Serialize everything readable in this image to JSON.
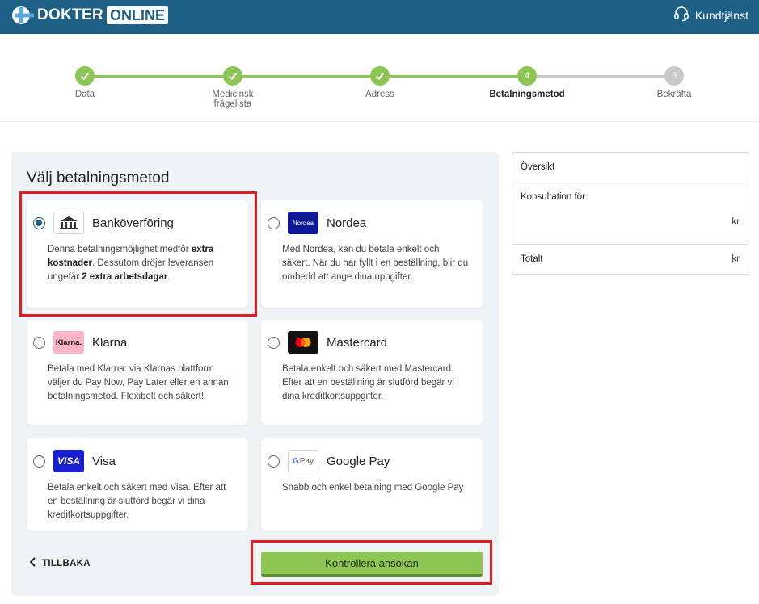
{
  "header": {
    "brand_part1": "DOKTER",
    "brand_part2": "ONLINE",
    "support_label": "Kundtjänst",
    "colors": {
      "bar": "#1e5f86"
    }
  },
  "stepper": {
    "steps": [
      {
        "number": "1",
        "label": "Data",
        "state": "done"
      },
      {
        "number": "2",
        "label": "Medicinsk\nfrågelista",
        "state": "done"
      },
      {
        "number": "3",
        "label": "Adress",
        "state": "done"
      },
      {
        "number": "4",
        "label": "Betalningsmetod",
        "state": "active"
      },
      {
        "number": "5",
        "label": "Bekräfta",
        "state": "todo"
      }
    ],
    "colors": {
      "done": "#8dc655",
      "todo": "#c9c9c9"
    }
  },
  "payment": {
    "title": "Välj betalningsmetod",
    "methods": [
      {
        "name": "Banköverföring",
        "selected": true,
        "icon": "bank-icon",
        "desc_parts": [
          "Denna betalningsmöjlighet medför ",
          "extra kostnader",
          ". Dessutom dröjer leveransen ungefär ",
          "2 extra arbetsdagar",
          "."
        ]
      },
      {
        "name": "Nordea",
        "selected": false,
        "icon": "nordea-logo",
        "logo_text": "Nordea",
        "desc": "Med Nordea, kan du betala enkelt och säkert. När du har fyllt i en beställning, blir du ombedd att ange dina uppgifter."
      },
      {
        "name": "Klarna",
        "selected": false,
        "icon": "klarna-logo",
        "logo_text": "Klarna.",
        "desc": "Betala med Klarna: via Klarnas plattform väljer du Pay Now, Pay Later eller en annan betalningsmetod. Flexibelt och säkert!"
      },
      {
        "name": "Mastercard",
        "selected": false,
        "icon": "mastercard-logo",
        "desc": "Betala enkelt och säkert med Mastercard. Efter att en beställning är slutförd begär vi dina kreditkortsuppgifter."
      },
      {
        "name": "Visa",
        "selected": false,
        "icon": "visa-logo",
        "logo_text": "VISA",
        "desc": "Betala enkelt och säkert med Visa. Efter att en beställning är slutförd begär vi dina kreditkortsuppgifter."
      },
      {
        "name": "Google Pay",
        "selected": false,
        "icon": "google-pay-logo",
        "logo_text": "Pay",
        "desc": "Snabb och enkel betalning med Google Pay"
      }
    ],
    "back_label": "TILLBAKA",
    "submit_label": "Kontrollera ansökan"
  },
  "overview": {
    "title": "Översikt",
    "consultation_label": "Konsultation för",
    "consultation_currency": "kr",
    "total_label": "Totalt",
    "total_currency": "kr"
  }
}
